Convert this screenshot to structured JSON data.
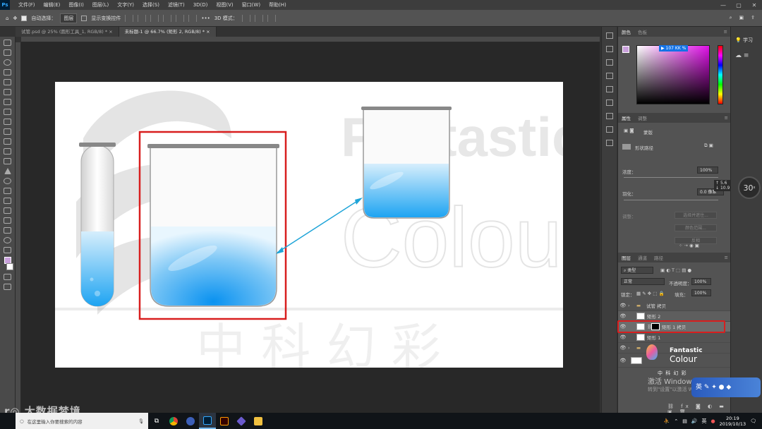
{
  "menubar": {
    "app_logo": "Ps",
    "items": [
      "文件(F)",
      "编辑(E)",
      "图像(I)",
      "图层(L)",
      "文字(Y)",
      "选择(S)",
      "滤镜(T)",
      "3D(D)",
      "视图(V)",
      "窗口(W)",
      "帮助(H)"
    ],
    "window_controls": [
      "—",
      "▢",
      "✕"
    ]
  },
  "options_bar": {
    "auto_select_label": "自动选择：",
    "auto_select_target": "图层",
    "show_transform_label": "显示变换控件",
    "more_label": "•••",
    "mode_label": "3D 模式："
  },
  "doc_tabs": [
    {
      "label": "试管.psd @ 25% (圆形工具_1, RGB/8) *",
      "close": "×"
    },
    {
      "label": "未标题-1 @ 66.7% (矩形 2, RGB/8) *",
      "close": "×"
    }
  ],
  "canvas_art": {
    "watermark_word_1": "Fantastic",
    "watermark_word_2": "Colour",
    "watermark_cn": "中 科 幻 彩",
    "colors": {
      "water_light": "#d6eefc",
      "water_deep": "#1ea4f2",
      "highlight_box": "#d81e1e",
      "arrow": "#1ea4d8"
    }
  },
  "panels": {
    "color": {
      "tabs": [
        "颜色",
        "色板"
      ],
      "hex_tip": "▶ 107 KK %",
      "fg_color": "#c9a0dc"
    },
    "properties": {
      "tabs": [
        "属性",
        "调整"
      ],
      "mask_label": "蒙版",
      "shape_label": "形状路径",
      "density_label": "浓度：",
      "density_value": "100%",
      "feather_label": "羽化：",
      "feather_value": "0.0 像素",
      "refine_label": "调整：",
      "select_subject_btn": "选择并遮住...",
      "color_range_btn": "颜色范围...",
      "invert_btn": "反相"
    },
    "layers": {
      "tabs": [
        "图层",
        "通道",
        "路径"
      ],
      "filter_kind": "类型",
      "blend_mode": "正常",
      "opacity_label": "不透明度：",
      "opacity_value": "100%",
      "lock_label": "锁定：",
      "fill_label": "填充：",
      "fill_value": "100%",
      "rows": [
        {
          "name": "试管 拷贝",
          "type": "group"
        },
        {
          "name": "矩形 2",
          "type": "shape"
        },
        {
          "name": "矩形 1 拷贝",
          "type": "shape-mask",
          "highlighted": true
        },
        {
          "name": "矩形 1",
          "type": "shape"
        },
        {
          "name": "",
          "type": "group"
        },
        {
          "name": "",
          "type": "logo"
        }
      ],
      "logo_text_1": "Fantastic",
      "logo_text_2": "Colour",
      "logo_cn": "中 科 幻 彩"
    }
  },
  "learn": {
    "label": "学习"
  },
  "zoom_badge": {
    "value": "30",
    "unit": "x",
    "readout_1": "5.6",
    "readout_2": "10.9"
  },
  "os_overlay": {
    "activate_title": "激活 Windows",
    "activate_sub": "转到\"设置\"以激活 Windows。",
    "ime_label": "英",
    "bottom_watermark": "大数据梦境"
  },
  "taskbar": {
    "search_placeholder": "在这里输入你要搜索的内容",
    "tray_lang": "英",
    "clock_time": "20:19",
    "clock_date": "2019/10/13"
  }
}
